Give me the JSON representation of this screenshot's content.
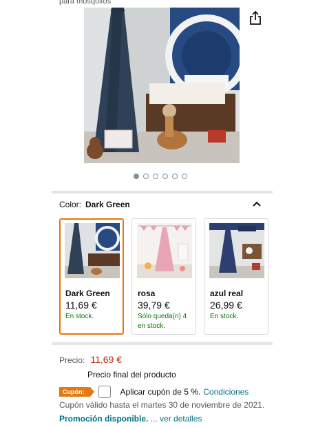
{
  "header": {
    "caption": "para mosquitos"
  },
  "gallery": {
    "image_count": 6,
    "active_index": 0
  },
  "color_selector": {
    "label": "Color:",
    "selected": "Dark Green",
    "options": [
      {
        "name": "Dark Green",
        "price": "11,69 €",
        "stock": "En stock.",
        "canopy_color": "#2f4157"
      },
      {
        "name": "rosa",
        "price": "39,79 €",
        "stock": "Sólo queda(n) 4 en stock.",
        "canopy_color": "#e9a5b5"
      },
      {
        "name": "azul real",
        "price": "26,99 €",
        "stock": "En stock.",
        "canopy_color": "#2c3f6e"
      }
    ]
  },
  "price": {
    "label": "Precio:",
    "value": "11,69 €",
    "final_note": "Precio final del producto"
  },
  "coupon": {
    "tag": "Cupón:",
    "text": "Aplicar cupón de 5 %.",
    "link": "Condiciones",
    "validity": "Cupón válido hasta el martes 30 de noviembre de 2021."
  },
  "promo": {
    "link": "Promoción disponible.",
    "more": "... ver detalles"
  },
  "colors": {
    "accent": "#e47911",
    "price": "#b12704",
    "link": "#007185",
    "stock": "#007600"
  }
}
